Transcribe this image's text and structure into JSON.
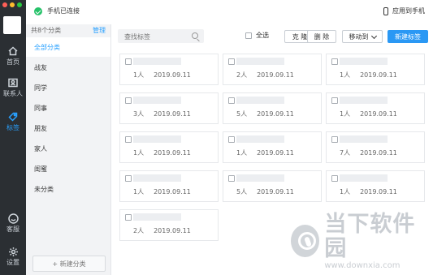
{
  "left_rail": {
    "items": [
      {
        "label": "首页",
        "icon": "home-icon"
      },
      {
        "label": "联系人",
        "icon": "contacts-icon"
      },
      {
        "label": "标签",
        "icon": "tag-icon"
      },
      {
        "label": "客服",
        "icon": "service-icon"
      },
      {
        "label": "设置",
        "icon": "settings-icon"
      }
    ],
    "active": "标签",
    "accent": "#29a1ff"
  },
  "topbar": {
    "connection": "手机已连接",
    "apply_to_phone": "应用到手机"
  },
  "categories": {
    "count_label": "共8个分类",
    "manage_label": "管理",
    "items": [
      "全部分类",
      "战友",
      "同学",
      "同事",
      "朋友",
      "家人",
      "闺蜜",
      "未分类"
    ],
    "active": "全部分类",
    "new_label": "+ 新建分类"
  },
  "toolbar": {
    "search_placeholder": "查找标签",
    "select_all": "全选",
    "copy": "克 隆",
    "delete": "删 除",
    "move_to": "移动到",
    "new_tag": "新建标签"
  },
  "cards": [
    {
      "count": "1人",
      "date": "2019.09.11"
    },
    {
      "count": "2人",
      "date": "2019.09.11"
    },
    {
      "count": "1人",
      "date": "2019.09.11"
    },
    {
      "count": "3人",
      "date": "2019.09.11"
    },
    {
      "count": "5人",
      "date": "2019.09.11"
    },
    {
      "count": "1人",
      "date": "2019.09.11"
    },
    {
      "count": "1人",
      "date": "2019.09.11"
    },
    {
      "count": "1人",
      "date": "2019.09.11"
    },
    {
      "count": "7人",
      "date": "2019.09.11"
    },
    {
      "count": "1人",
      "date": "2019.09.11"
    },
    {
      "count": "5人",
      "date": "2019.09.11"
    },
    {
      "count": "1人",
      "date": "2019.09.11"
    },
    {
      "count": "2人",
      "date": "2019.09.11"
    }
  ],
  "watermark": {
    "text": "当下软件园",
    "url": "www.downxia.com"
  }
}
